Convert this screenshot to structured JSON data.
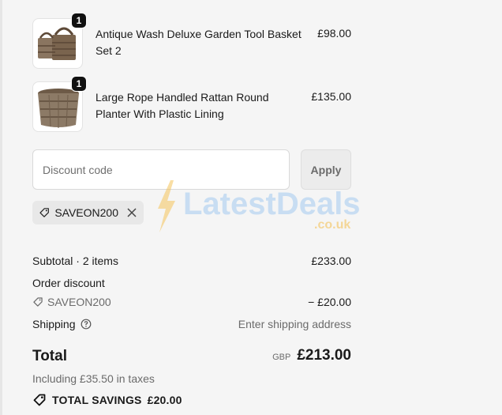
{
  "line_items": [
    {
      "name": "Antique Wash Deluxe Garden Tool Basket Set 2",
      "price": "£98.00",
      "quantity": "1"
    },
    {
      "name": "Large Rope Handled Rattan Round Planter With Plastic Lining",
      "price": "£135.00",
      "quantity": "1"
    }
  ],
  "discount": {
    "placeholder": "Discount code",
    "apply_label": "Apply",
    "applied_code": "SAVEON200"
  },
  "summary": {
    "subtotal_label": "Subtotal · 2 items",
    "subtotal_value": "£233.00",
    "order_discount_label": "Order discount",
    "discount_code": "SAVEON200",
    "discount_value": "− £20.00",
    "shipping_label": "Shipping",
    "shipping_value": "Enter shipping address",
    "total_label": "Total",
    "currency": "GBP",
    "total_value": "£213.00",
    "taxes_note": "Including £35.50 in taxes",
    "savings_label": "TOTAL SAVINGS",
    "savings_value": "£20.00"
  },
  "watermark": {
    "brand_text": "LatestDeals",
    "domain_text": ".co.uk"
  },
  "icons": [
    "tag-icon",
    "close-icon",
    "help-circle-icon",
    "savings-tag-icon"
  ]
}
